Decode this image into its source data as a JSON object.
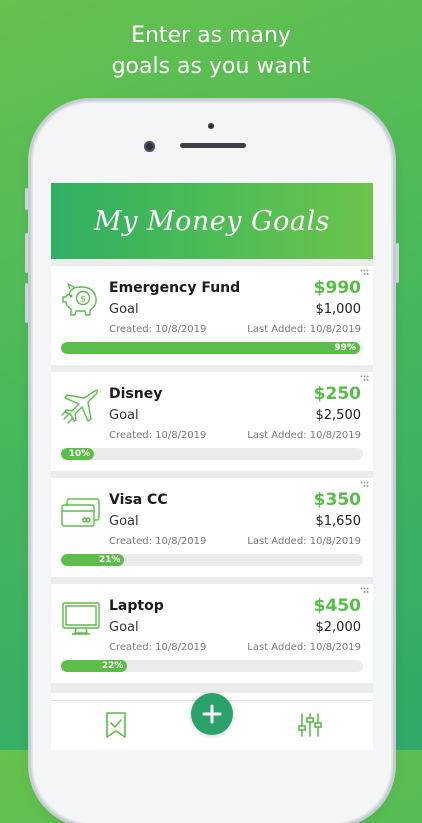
{
  "headline": {
    "line1": "Enter as many",
    "line2": "goals as you want"
  },
  "app": {
    "title": "My Money Goals"
  },
  "goals": [
    {
      "name": "Emergency Fund",
      "icon": "piggy-bank-icon",
      "saved": "$990",
      "goal_label": "Goal",
      "goal": "$1,000",
      "created": "Created: 10/8/2019",
      "last_added": "Last Added: 10/8/2019",
      "progress_label": "99%",
      "progress": 0.99
    },
    {
      "name": "Disney",
      "icon": "airplane-icon",
      "saved": "$250",
      "goal_label": "Goal",
      "goal": "$2,500",
      "created": "Created: 10/8/2019",
      "last_added": "Last Added: 10/8/2019",
      "progress_label": "10%",
      "progress": 0.1
    },
    {
      "name": "Visa CC",
      "icon": "credit-card-icon",
      "saved": "$350",
      "goal_label": "Goal",
      "goal": "$1,650",
      "created": "Created: 10/8/2019",
      "last_added": "Last Added: 10/8/2019",
      "progress_label": "21%",
      "progress": 0.21
    },
    {
      "name": "Laptop",
      "icon": "computer-monitor-icon",
      "saved": "$450",
      "goal_label": "Goal",
      "goal": "$2,000",
      "created": "Created: 10/8/2019",
      "last_added": "Last Added: 10/8/2019",
      "progress_label": "22%",
      "progress": 0.22
    }
  ],
  "tabbar": {
    "left_icon": "bookmark-check-icon",
    "center_icon": "plus-icon",
    "right_icon": "sliders-icon"
  },
  "colors": {
    "accent": "#5cbd4a",
    "header_start": "#2fae63",
    "header_end": "#6cc34c",
    "fab": "#2aa269",
    "background": "#4cb95a"
  }
}
